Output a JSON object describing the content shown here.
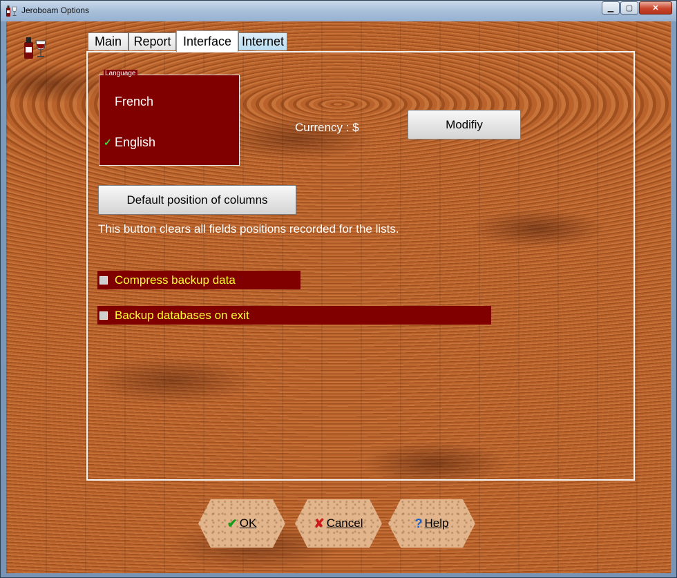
{
  "window": {
    "title": "Jeroboam Options"
  },
  "tabs": [
    {
      "label": "Main"
    },
    {
      "label": "Report"
    },
    {
      "label": "Interface"
    },
    {
      "label": "Internet"
    }
  ],
  "language": {
    "legend": "Language",
    "options": [
      {
        "label": "French"
      },
      {
        "label": "English"
      }
    ],
    "selected_check": "✓"
  },
  "currency": {
    "label": "Currency : $"
  },
  "buttons": {
    "modify": "Modifiy",
    "default_columns": "Default position of columns",
    "ok": "OK",
    "cancel": "Cancel",
    "help": "Help"
  },
  "hint": "This button clears all fields positions recorded for the lists.",
  "checkboxes": [
    {
      "label": "Compress backup data"
    },
    {
      "label": "Backup databases on exit"
    }
  ],
  "colors": {
    "accent": "#800000",
    "checkbox_text": "#ffff33",
    "check_green": "#38d838"
  }
}
